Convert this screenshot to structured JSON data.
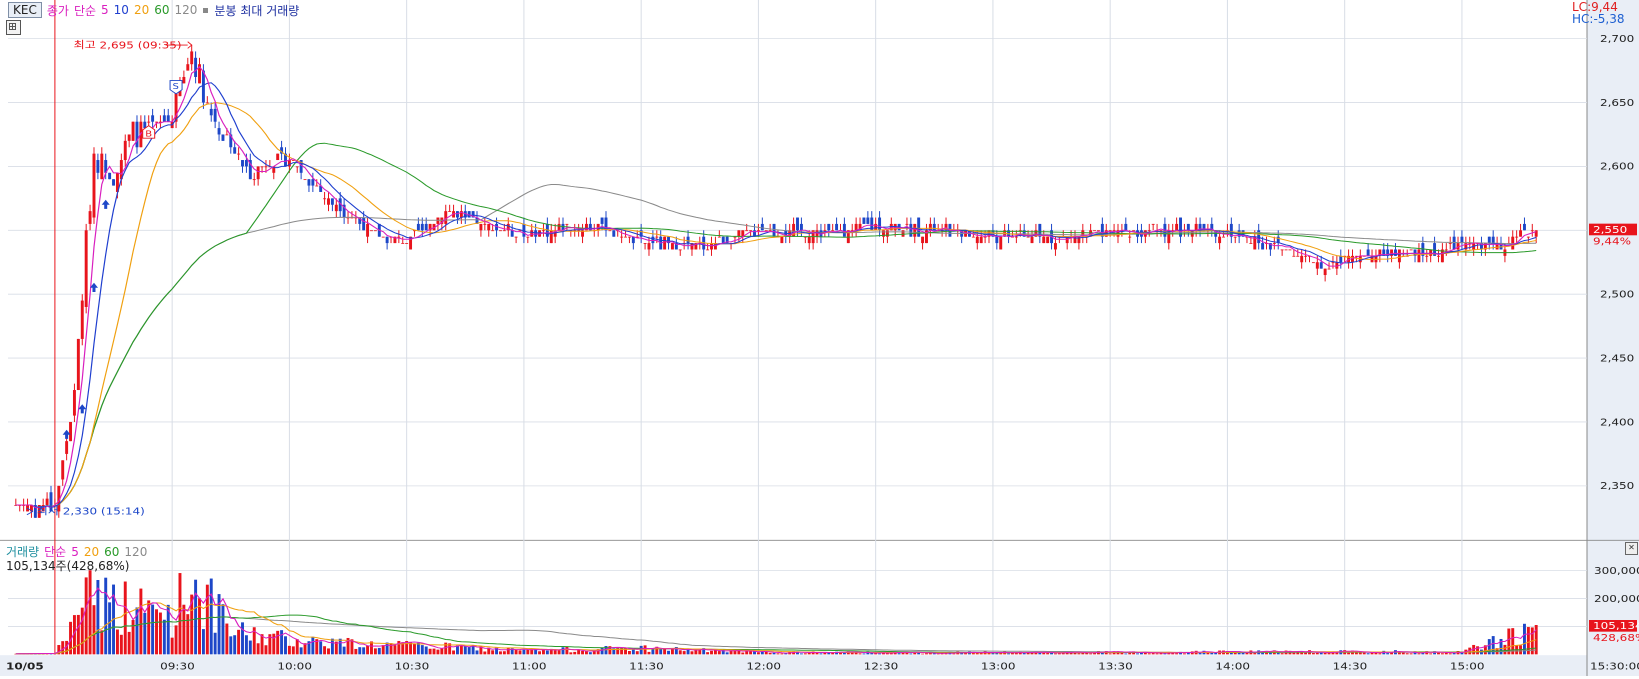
{
  "legend": {
    "symbol": "KEC",
    "price_type": "종가",
    "ma_type": "단순",
    "ma_periods": [
      "5",
      "10",
      "20",
      "60",
      "120"
    ],
    "extra": "분봉 최대 거래량"
  },
  "volume_legend": {
    "title": "거래량",
    "ma_type": "단순",
    "ma_periods": [
      "5",
      "20",
      "60",
      "120"
    ],
    "info": "105,134주(428,68%)"
  },
  "corner": {
    "lc": "LC:9,44",
    "hc": "HC:-5,38"
  },
  "colors": {
    "up": "#e8141c",
    "down": "#1d47c8",
    "ma5": "#d91fbf",
    "ma10": "#1f3fcf",
    "ma20": "#f0a010",
    "ma60": "#2a9a2a",
    "ma120": "#8a8a8a",
    "grid": "#d8dde6",
    "axis_bg": "#e9eef6"
  },
  "chart_data": [
    {
      "type": "candlestick",
      "title": "KEC",
      "date_label": "10/05",
      "x_tick_labels": [
        "09:30",
        "10:00",
        "10:30",
        "11:00",
        "11:30",
        "12:00",
        "12:30",
        "13:00",
        "13:30",
        "14:00",
        "14:30",
        "15:00",
        "15:30:00"
      ],
      "y_tick_labels": [
        "2,700",
        "2,650",
        "2,600",
        "2,550",
        "2,500",
        "2,450",
        "2,400",
        "2,350"
      ],
      "ylim": [
        2310,
        2712
      ],
      "annotations": {
        "high": "최고 2,695 (09:35)",
        "low": "최저 2,330 (15:14)",
        "signal_buy": "B",
        "signal_sell": "S"
      },
      "current_price": "2,550",
      "current_change": "9,44%",
      "anchor_series": [
        {
          "time": "09:00",
          "close": 2335
        },
        {
          "time": "09:05",
          "close": 2420
        },
        {
          "time": "09:08",
          "close": 2540
        },
        {
          "time": "09:10",
          "close": 2610
        },
        {
          "time": "09:15",
          "close": 2595
        },
        {
          "time": "09:20",
          "close": 2625
        },
        {
          "time": "09:25",
          "close": 2628
        },
        {
          "time": "09:30",
          "close": 2640
        },
        {
          "time": "09:35",
          "close": 2690
        },
        {
          "time": "09:40",
          "close": 2640
        },
        {
          "time": "09:50",
          "close": 2592
        },
        {
          "time": "09:55",
          "close": 2605
        },
        {
          "time": "10:00",
          "close": 2605
        },
        {
          "time": "10:10",
          "close": 2575
        },
        {
          "time": "10:20",
          "close": 2550
        },
        {
          "time": "10:30",
          "close": 2540
        },
        {
          "time": "10:40",
          "close": 2565
        },
        {
          "time": "10:50",
          "close": 2553
        },
        {
          "time": "11:00",
          "close": 2548
        },
        {
          "time": "11:10",
          "close": 2551
        },
        {
          "time": "11:20",
          "close": 2553
        },
        {
          "time": "11:30",
          "close": 2540
        },
        {
          "time": "11:45",
          "close": 2538
        },
        {
          "time": "12:00",
          "close": 2550
        },
        {
          "time": "12:15",
          "close": 2548
        },
        {
          "time": "12:30",
          "close": 2553
        },
        {
          "time": "12:45",
          "close": 2550
        },
        {
          "time": "13:00",
          "close": 2545
        },
        {
          "time": "13:15",
          "close": 2545
        },
        {
          "time": "13:30",
          "close": 2548
        },
        {
          "time": "13:45",
          "close": 2550
        },
        {
          "time": "14:00",
          "close": 2548
        },
        {
          "time": "14:15",
          "close": 2535
        },
        {
          "time": "14:25",
          "close": 2522
        },
        {
          "time": "14:35",
          "close": 2532
        },
        {
          "time": "14:50",
          "close": 2530
        },
        {
          "time": "15:00",
          "close": 2538
        },
        {
          "time": "15:10",
          "close": 2540
        },
        {
          "time": "15:19",
          "close": 2550
        }
      ]
    },
    {
      "type": "bar",
      "title": "거래량",
      "y_tick_labels": [
        "300,000",
        "200,000"
      ],
      "ylim": [
        0,
        340000
      ],
      "current_volume": "105,134",
      "current_ratio": "428,68%",
      "anchor_series": [
        {
          "time": "09:00",
          "volume": 8000
        },
        {
          "time": "09:05",
          "volume": 120000
        },
        {
          "time": "09:08",
          "volume": 330000
        },
        {
          "time": "09:12",
          "volume": 220000
        },
        {
          "time": "09:20",
          "volume": 180000
        },
        {
          "time": "09:30",
          "volume": 160000
        },
        {
          "time": "09:35",
          "volume": 300000
        },
        {
          "time": "09:45",
          "volume": 90000
        },
        {
          "time": "10:00",
          "volume": 60000
        },
        {
          "time": "10:20",
          "volume": 40000
        },
        {
          "time": "10:40",
          "volume": 30000
        },
        {
          "time": "11:00",
          "volume": 15000
        },
        {
          "time": "11:30",
          "volume": 25000
        },
        {
          "time": "12:00",
          "volume": 8000
        },
        {
          "time": "13:00",
          "volume": 7000
        },
        {
          "time": "14:00",
          "volume": 10000
        },
        {
          "time": "14:30",
          "volume": 12000
        },
        {
          "time": "15:00",
          "volume": 9000
        },
        {
          "time": "15:19",
          "volume": 105134
        }
      ]
    }
  ]
}
